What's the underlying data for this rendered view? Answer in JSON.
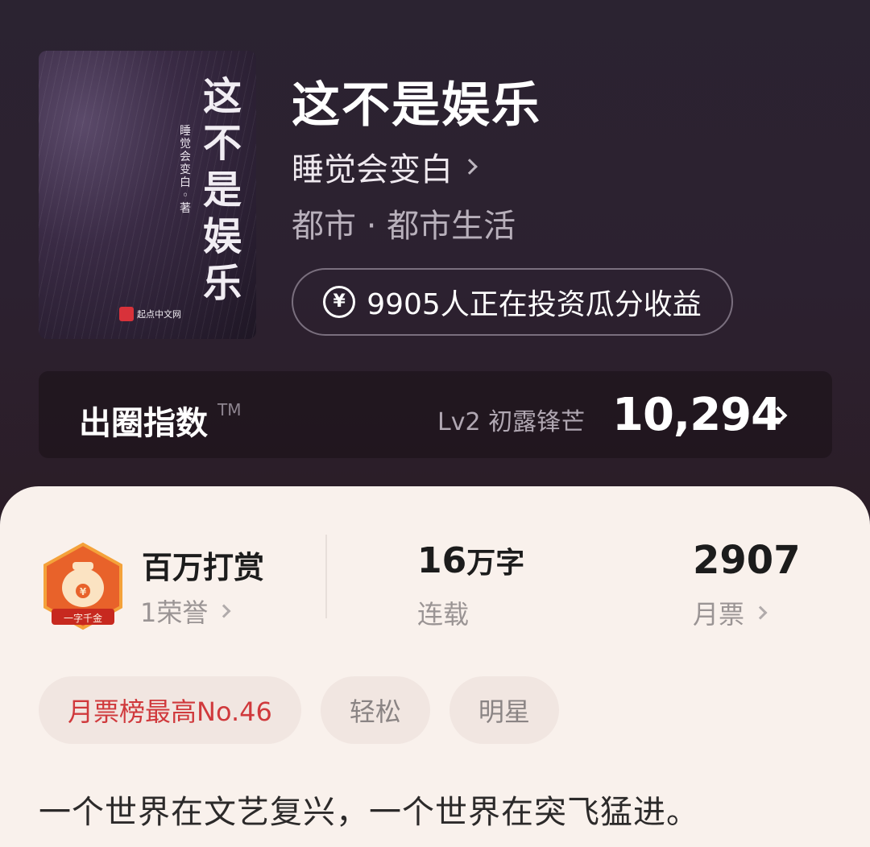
{
  "book": {
    "title": "这不是娱乐",
    "author": "睡觉会变白",
    "genre": "都市 · 都市生活",
    "invest_text": "9905人正在投资瓜分收益",
    "invest_icon": "yen-circle-icon"
  },
  "cover": {
    "title_chars": [
      "这",
      "不",
      "是",
      "娱",
      "乐"
    ],
    "author_chars": [
      "睡",
      "觉",
      "会",
      "变",
      "白",
      "◦",
      "著"
    ],
    "publisher": "起点中文网"
  },
  "index": {
    "label": "出圈指数",
    "tm": "TM",
    "level": "Lv2 初露锋芒",
    "value": "10,294"
  },
  "stats": {
    "reward_title": "百万打赏",
    "reward_sub": "1荣誉",
    "badge_text": "一字千金",
    "words_value": "16",
    "words_unit": "万字",
    "words_sub": "连载",
    "votes_value": "2907",
    "votes_sub": "月票"
  },
  "tags": [
    "月票榜最高No.46",
    "轻松",
    "明星"
  ],
  "intro": "一个世界在文艺复兴，一个世界在突飞猛进。",
  "colors": {
    "hero_bg": "#2b2331",
    "sheet_bg": "#f9f1ec",
    "accent_red": "#d0393c",
    "badge_orange": "#e8622a"
  }
}
